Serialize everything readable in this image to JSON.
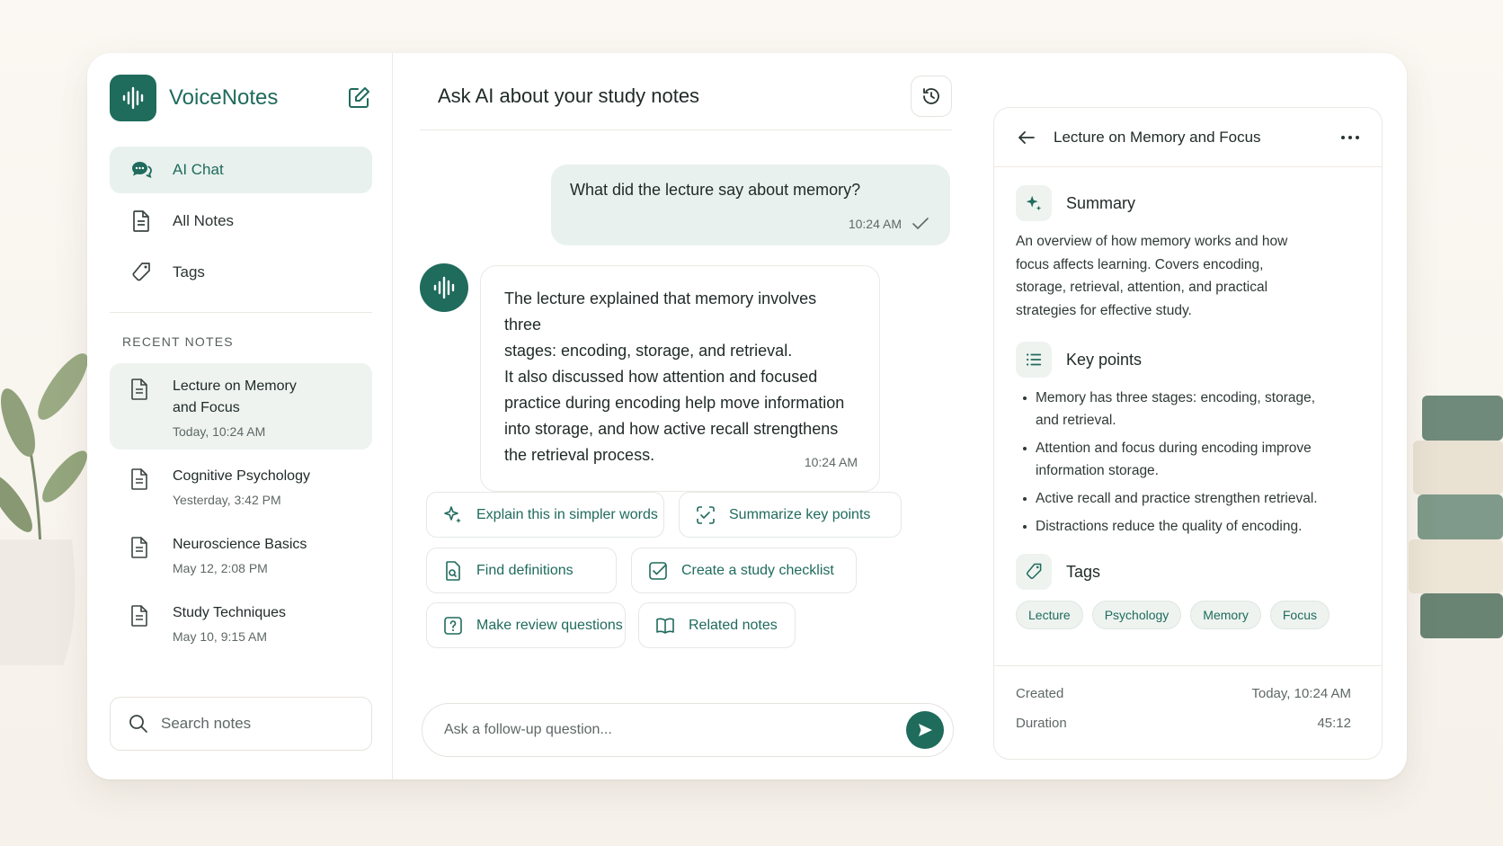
{
  "app": {
    "name": "VoiceNotes",
    "accent": "#1f6b5c"
  },
  "sidebar": {
    "nav": [
      {
        "label": "AI Chat",
        "icon": "chat-bubbles-icon",
        "active": true
      },
      {
        "label": "All Notes",
        "icon": "document-icon"
      },
      {
        "label": "Tags",
        "icon": "tag-icon"
      }
    ],
    "recent_label": "RECENT NOTES",
    "recent": [
      {
        "title": "Lecture on Memory and Focus",
        "date": "Today, 10:24 AM",
        "active": true
      },
      {
        "title": "Cognitive Psychology",
        "date": "Yesterday, 3:42 PM"
      },
      {
        "title": "Neuroscience Basics",
        "date": "May 12, 2:08 PM"
      },
      {
        "title": "Study Techniques",
        "date": "May 10, 9:15 AM"
      }
    ],
    "search_placeholder": "Search notes"
  },
  "chat": {
    "title": "Ask AI about your study notes",
    "user_message": {
      "text": "What did the lecture say about memory?",
      "time": "10:24 AM"
    },
    "ai_message": {
      "lines": [
        "The lecture explained that memory involves three",
        "stages: encoding, storage, and retrieval.",
        "It also discussed how attention and focused",
        "practice during encoding help move information",
        "into storage, and how active recall strengthens",
        "the retrieval process."
      ],
      "time": "10:24 AM"
    },
    "suggestions": [
      {
        "label": "Explain this in simpler words",
        "icon": "sparkle-icon"
      },
      {
        "label": "Summarize key points",
        "icon": "checklist-scan-icon"
      },
      {
        "label": "Find definitions",
        "icon": "document-search-icon"
      },
      {
        "label": "Create a study checklist",
        "icon": "checkbox-icon"
      },
      {
        "label": "Make review questions",
        "icon": "question-icon"
      },
      {
        "label": "Related notes",
        "icon": "book-icon"
      }
    ],
    "composer_placeholder": "Ask a follow-up question..."
  },
  "detail": {
    "title": "Lecture on Memory and Focus",
    "summary_title": "Summary",
    "summary_text": "An overview of how memory works and how focus affects learning. Covers encoding, storage, retrieval, attention, and practical strategies for effective study.",
    "key_points_title": "Key points",
    "key_points": [
      "Memory has three stages: encoding, storage, and retrieval.",
      "Attention and focus during encoding improve information storage.",
      "Active recall and practice strengthen retrieval.",
      "Distractions reduce the quality of encoding."
    ],
    "tags_title": "Tags",
    "tags": [
      "Lecture",
      "Psychology",
      "Memory",
      "Focus"
    ],
    "meta": {
      "created_label": "Created",
      "created_value": "Today, 10:24 AM",
      "duration_label": "Duration",
      "duration_value": "45:12"
    }
  }
}
